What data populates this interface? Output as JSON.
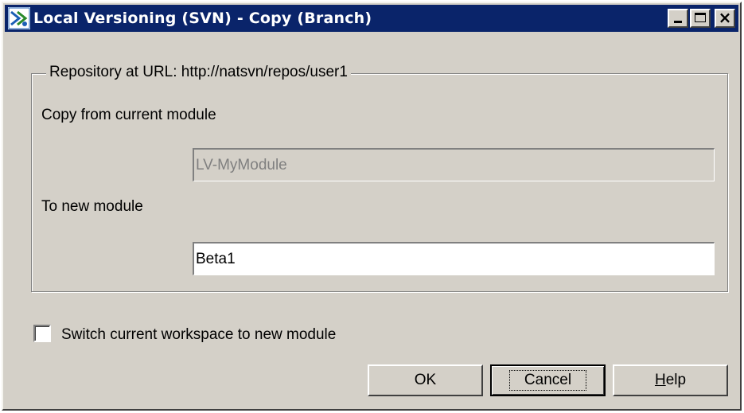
{
  "window": {
    "title": "Local Versioning (SVN) - Copy (Branch)",
    "title_bar_color": "#0a246a",
    "face_color": "#d4d0c8",
    "icon": "labview-app-icon",
    "controls": [
      "minimize-icon",
      "maximize-icon",
      "close-icon"
    ]
  },
  "group": {
    "legend": "Repository at URL: http://natsvn/repos/user1",
    "copy_from_label": "Copy from current module",
    "copy_from_value": "LV-MyModule",
    "to_label": "To new module",
    "to_value": "Beta1"
  },
  "switch_checkbox": {
    "label": "Switch current workspace to new module",
    "checked": false
  },
  "buttons": {
    "ok": "OK",
    "cancel": "Cancel",
    "help_mnemonic": "H",
    "help_rest": "elp"
  }
}
